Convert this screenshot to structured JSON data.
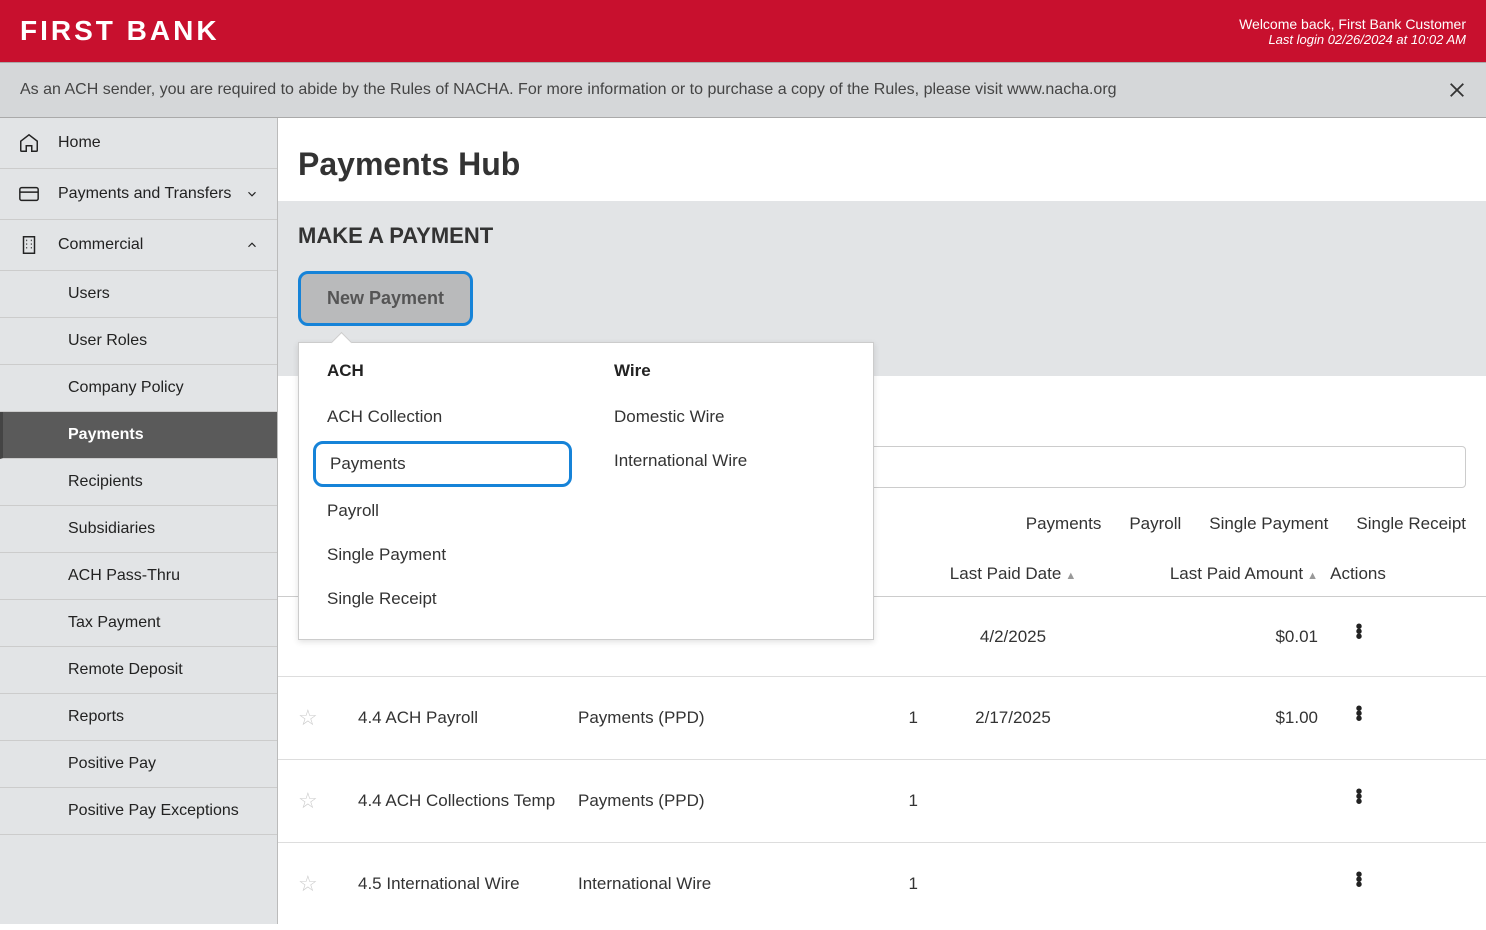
{
  "header": {
    "logo": "FIRST BANK",
    "welcome": "Welcome back, First Bank Customer",
    "last_login": "Last login 02/26/2024 at 10:02 AM"
  },
  "notice": {
    "text": "As an ACH sender, you are required to abide by the Rules of NACHA. For more information or to purchase a copy of the Rules, please visit www.nacha.org"
  },
  "sidebar": {
    "home": "Home",
    "payments_transfers": "Payments and Transfers",
    "commercial": "Commercial",
    "sub": {
      "users": "Users",
      "user_roles": "User Roles",
      "company_policy": "Company Policy",
      "payments": "Payments",
      "recipients": "Recipients",
      "subsidiaries": "Subsidiaries",
      "ach_pass_thru": "ACH Pass-Thru",
      "tax_payment": "Tax Payment",
      "remote_deposit": "Remote Deposit",
      "reports": "Reports",
      "positive_pay": "Positive Pay",
      "positive_pay_exceptions": "Positive Pay Exceptions"
    }
  },
  "main": {
    "page_title": "Payments Hub",
    "section_heading": "MAKE A PAYMENT",
    "new_payment_btn": "New Payment",
    "dropdown": {
      "ach": {
        "head": "ACH",
        "opts": [
          "ACH Collection",
          "Payments",
          "Payroll",
          "Single Payment",
          "Single Receipt"
        ]
      },
      "wire": {
        "head": "Wire",
        "opts": [
          "Domestic Wire",
          "International Wire"
        ]
      }
    },
    "filters": [
      "Payments",
      "Payroll",
      "Single Payment",
      "Single Receipt"
    ],
    "table": {
      "headers": {
        "last_paid_date": "Last Paid Date",
        "last_paid_amount": "Last Paid Amount",
        "actions": "Actions"
      },
      "rows": [
        {
          "name": "",
          "type": "",
          "recip": "",
          "date": "4/2/2025",
          "amount": "$0.01"
        },
        {
          "name": "4.4 ACH Payroll",
          "type": "Payments (PPD)",
          "recip": "1",
          "date": "2/17/2025",
          "amount": "$1.00"
        },
        {
          "name": "4.4 ACH Collections Temp",
          "type": "Payments (PPD)",
          "recip": "1",
          "date": "",
          "amount": ""
        },
        {
          "name": "4.5 International Wire",
          "type": "International Wire",
          "recip": "1",
          "date": "",
          "amount": ""
        }
      ]
    }
  }
}
